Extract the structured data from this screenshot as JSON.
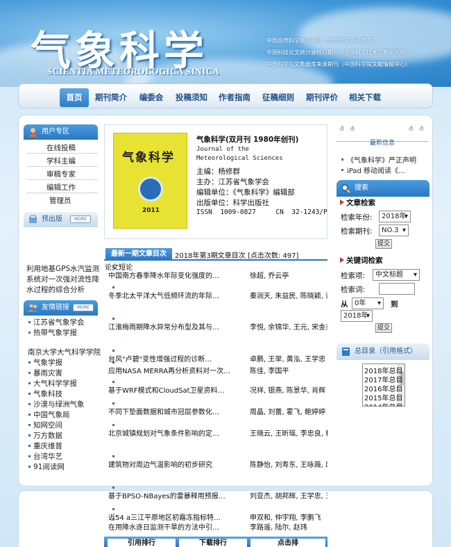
{
  "header": {
    "logo_cn": "气象科学",
    "logo_en": "SCIENTIA METEOROLOGICA SINICA",
    "lines": [
      "中国自然科学核心期刊（北京大学图书馆等）",
      "中国科技论文统计源核心期刊（中国科学技术信息研究所）",
      "中国科学引文数据库来源期刊（中国科学院文献情报中心）"
    ]
  },
  "nav": [
    "首页",
    "期刊简介",
    "编委会",
    "投稿须知",
    "作者指南",
    "征稿细则",
    "期刊评价",
    "相关下载"
  ],
  "user_zone": {
    "title": "用户专区",
    "items": [
      "在线投稿",
      "学科主编",
      "审稿专家",
      "编辑工作",
      "管理员"
    ]
  },
  "preprint": {
    "title": "预出版",
    "more": "MORE",
    "article": "利用地基GPS水汽监测系统对一次强对流性降水过程的综合分析"
  },
  "links": {
    "title": "友情链接",
    "more": "MORE",
    "items": [
      "江苏省气象学会",
      "热带气象学报",
      "南京大学大气科学学院",
      "气象学报",
      "暴雨灾害",
      "大气科学学报",
      "气象科技",
      "沙漠与绿洲气象",
      "中国气象局",
      "知网空间",
      "万方数据",
      "重庆维普",
      "台湾华艺",
      "91阅读网"
    ]
  },
  "journal": {
    "name": "气象科学(双月刊 1980年创刊)",
    "en_name": "Journal of the Meteorological Sciences",
    "editor": "主编：杨修群",
    "sponsor": "主办：江苏省气象学会",
    "unit": "编辑单位：《气象科学》编辑部",
    "publisher": "出版单位：科学出版社",
    "issn": "ISSN  1009-0827     CN  32-1243/P",
    "cover_title": "气象科学",
    "cover_year": "2011"
  },
  "latest": {
    "tab": "最新一期文章目次",
    "desc": "2018年第3期文章目次 [点击次数: 497]",
    "section": "论文短论",
    "articles": [
      {
        "title": "中国南方春季降水年际变化强度的…",
        "authors": "徐超, 乔云亭"
      },
      {
        "title": "冬季北太平洋大气低频环流的年际…",
        "authors": "秦润天, 朱益民, 陈晓颖, 谢情, 钱晨"
      },
      {
        "title": "江淮梅雨期降水异常分布型及其与…",
        "authors": "李悦, 余锦华, 王元, 宋金杰, 庄园"
      },
      {
        "title": "台风\"卢碧\"变性增强过程的诊断…",
        "authors": "卓鹏, 王举, 黄泓, 王学忠"
      },
      {
        "title": "应用NASA MERRA再分析资料对一次…",
        "authors": "陈佳, 李国平"
      },
      {
        "title": "基于WRF模式和CloudSat卫星资料…",
        "authors": "况祥, 银燕, 陈景华, 肖辉"
      },
      {
        "title": "不同下垫面数据和城市冠层参数化…",
        "authors": "周晶, 刘蕾, 霍飞, 鲍婷婷"
      },
      {
        "title": "北京城镇规划对气象条件影响的定…",
        "authors": "王晓云, 王昕瑶, 李忠良, 程宸, 曾宪宁, 房小怡"
      },
      {
        "title": "建筑物对周边气温影响的初步研究",
        "authors": "陈静怡, 刘寿东, 王咏薇, 邱田田, 李立"
      },
      {
        "title": "基于BPSO-NBayes的雷暴释用预报…",
        "authors": "刘亚杰, 胡邦辉, 王学忠, 王举, 黄泓"
      },
      {
        "title": "近54 a三江平原地区初霜冻指标特…",
        "authors": "申双和, 仲宇翔, 李鹏飞"
      },
      {
        "title": "在用降水逐日监测干旱的方法中引…",
        "authors": "李路遥, 陆尔, 赵玮"
      }
    ]
  },
  "rank_tabs": [
    "引用排行",
    "下载排行",
    "点击排"
  ],
  "notices": {
    "title": "最新信息",
    "items": [
      "《气象科学》严正声明",
      "iPad 移动阅读《…"
    ]
  },
  "search": {
    "title": "搜索",
    "article_search": "文章检索",
    "year_label": "检索年份:",
    "year_value": "2018年",
    "issue_label": "检索期刊:",
    "issue_value": "NO.3",
    "go": "提交",
    "keyword_search": "关键词检索",
    "field_label": "检索项:",
    "field_value": "中文标题",
    "term_label": "检索词:",
    "term_value": "",
    "from_label": "从",
    "from_value": "0年",
    "to_label": "到",
    "to_value": "2018年",
    "go2": "提交"
  },
  "archive": {
    "title": "总目录（引用格式）",
    "items": [
      "2018年总目",
      "2017年总目",
      "2016年总目",
      "2015年总目",
      "2014年总目"
    ]
  }
}
